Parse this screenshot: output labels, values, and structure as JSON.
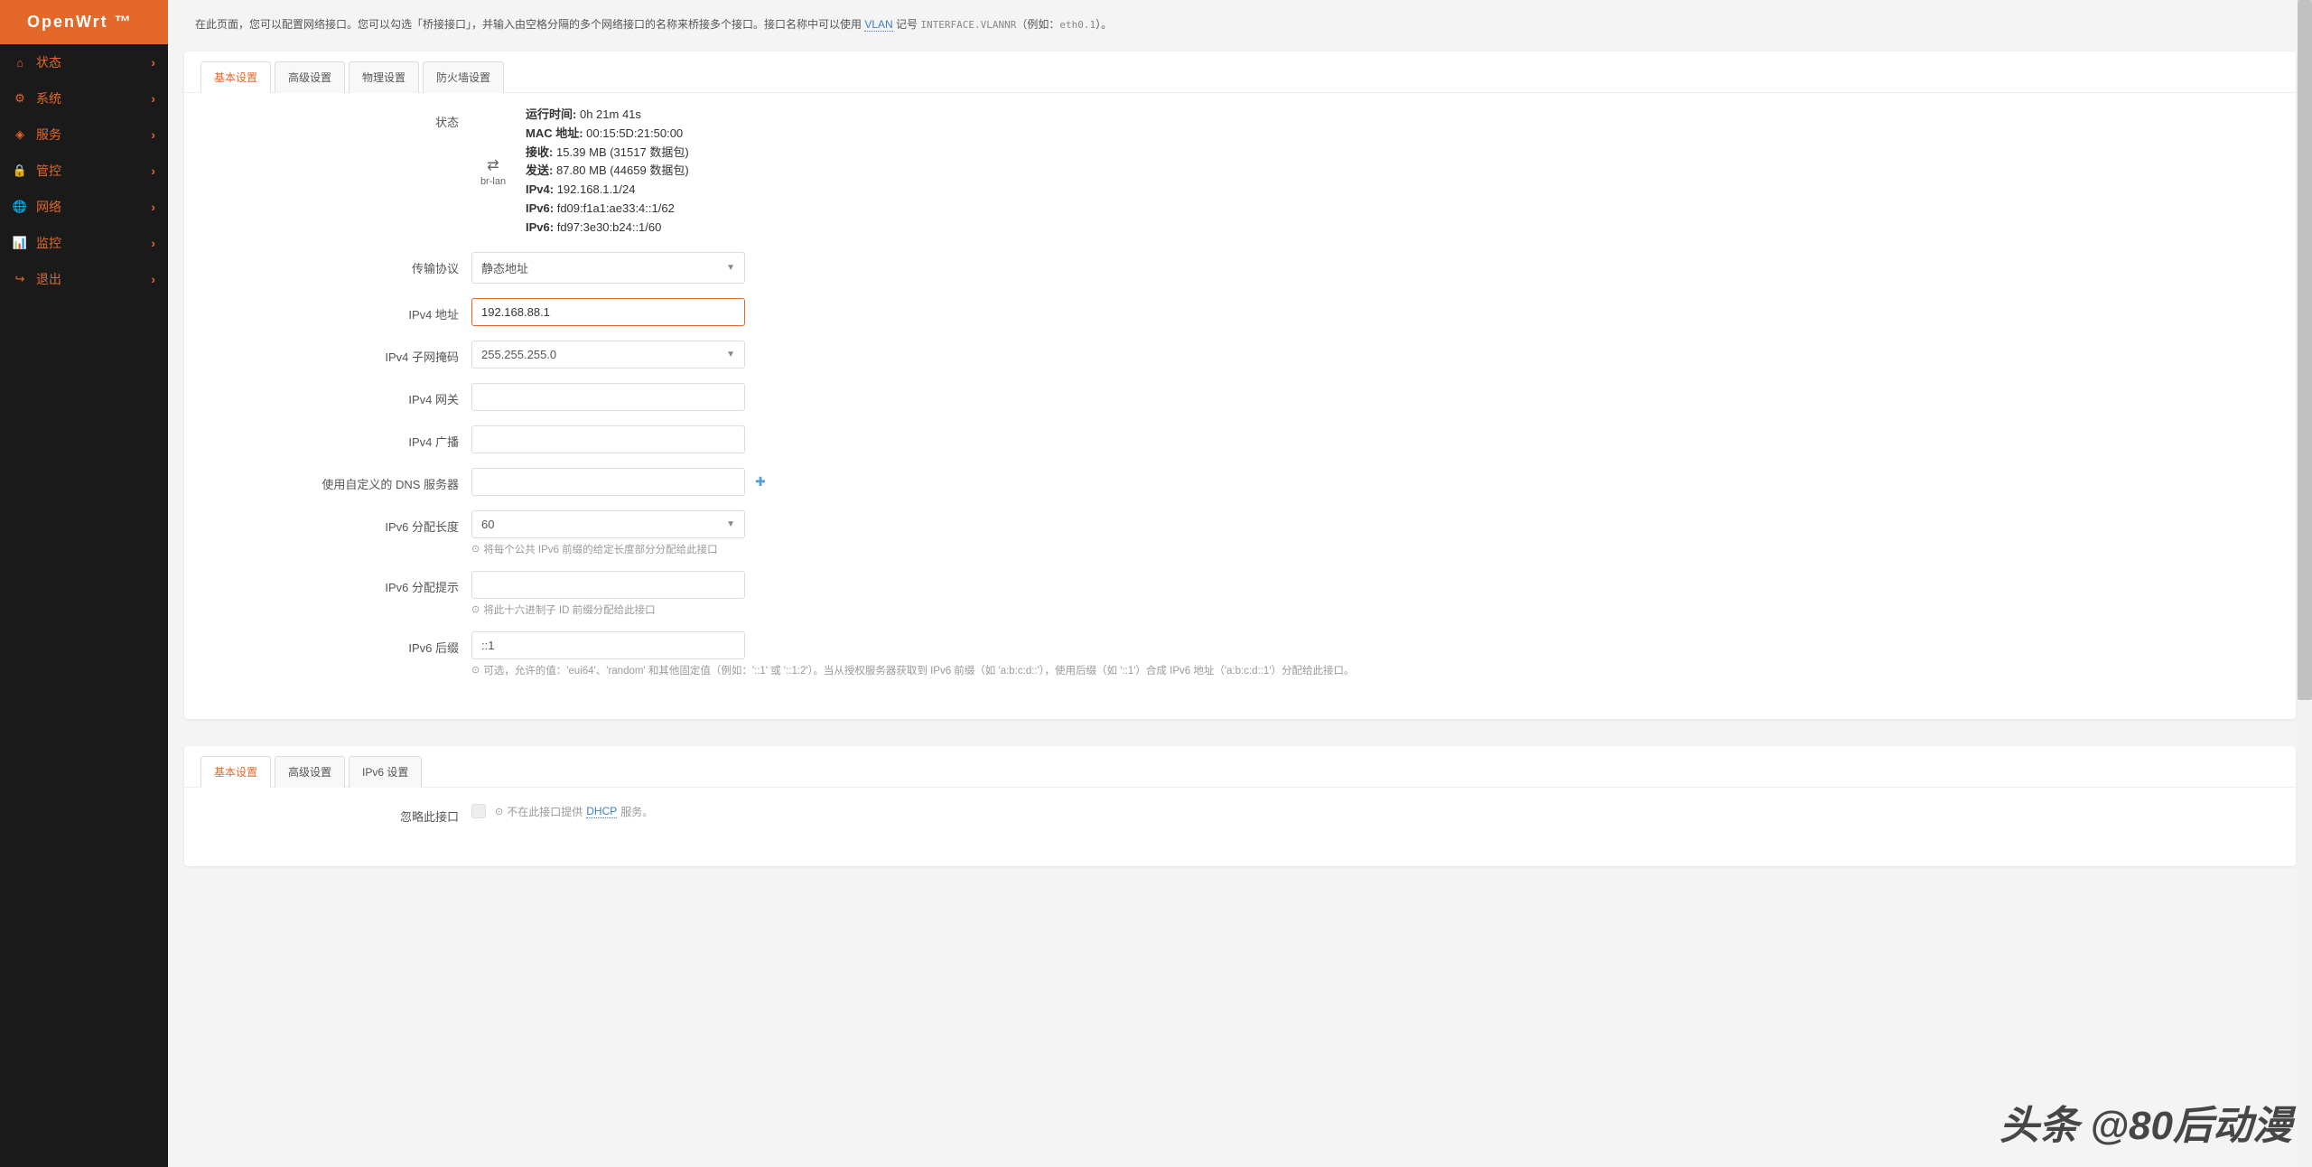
{
  "brand": "OpenWrt ™",
  "sidebar": {
    "items": [
      {
        "icon": "⌂",
        "icon_color": "#4a90d9",
        "label": "状态"
      },
      {
        "icon": "⚙",
        "icon_color": "#e4682a",
        "label": "系统"
      },
      {
        "icon": "◈",
        "icon_color": "#9b5de5",
        "label": "服务"
      },
      {
        "icon": "🔒",
        "icon_color": "#3ab0b0",
        "label": "管控"
      },
      {
        "icon": "🌐",
        "icon_color": "#4a90d9",
        "label": "网络"
      },
      {
        "icon": "📊",
        "icon_color": "#5cb85c",
        "label": "监控"
      },
      {
        "icon": "↪",
        "icon_color": "#d9534f",
        "label": "退出"
      }
    ]
  },
  "page": {
    "desc_prefix": "在此页面，您可以配置网络接口。您可以勾选「桥接接口」，并输入由空格分隔的多个网络接口的名称来桥接多个接口。接口名称中可以使用 ",
    "desc_link": "VLAN",
    "desc_mid": " 记号 ",
    "desc_code1": "INTERFACE.VLANNR",
    "desc_mid2": "（例如：",
    "desc_code2": "eth0.1",
    "desc_suffix": "）。"
  },
  "panel1": {
    "tabs": [
      {
        "label": "基本设置",
        "active": true
      },
      {
        "label": "高级设置",
        "active": false
      },
      {
        "label": "物理设置",
        "active": false
      },
      {
        "label": "防火墙设置",
        "active": false
      }
    ],
    "status": {
      "label": "状态",
      "iface_name": "br-lan",
      "uptime_k": "运行时间:",
      "uptime_v": "0h 21m 41s",
      "mac_k": "MAC 地址:",
      "mac_v": "00:15:5D:21:50:00",
      "rx_k": "接收:",
      "rx_v": "15.39 MB (31517 数据包)",
      "tx_k": "发送:",
      "tx_v": "87.80 MB (44659 数据包)",
      "ipv4_k": "IPv4:",
      "ipv4_v": "192.168.1.1/24",
      "ipv6a_k": "IPv6:",
      "ipv6a_v": "fd09:f1a1:ae33:4::1/62",
      "ipv6b_k": "IPv6:",
      "ipv6b_v": "fd97:3e30:b24::1/60"
    },
    "protocol": {
      "label": "传输协议",
      "value": "静态地址"
    },
    "ipv4_addr": {
      "label": "IPv4 地址",
      "value": "192.168.88.1"
    },
    "ipv4_mask": {
      "label": "IPv4 子网掩码",
      "value": "255.255.255.0"
    },
    "ipv4_gw": {
      "label": "IPv4 网关",
      "value": ""
    },
    "ipv4_bc": {
      "label": "IPv4 广播",
      "value": ""
    },
    "dns": {
      "label": "使用自定义的 DNS 服务器",
      "value": ""
    },
    "ipv6_len": {
      "label": "IPv6 分配长度",
      "value": "60",
      "help": "将每个公共 IPv6 前缀的给定长度部分分配给此接口"
    },
    "ipv6_hint": {
      "label": "IPv6 分配提示",
      "value": "",
      "help": "将此十六进制子 ID 前缀分配给此接口"
    },
    "ipv6_suffix": {
      "label": "IPv6 后缀",
      "value": "::1",
      "help": "可选，允许的值：'eui64'、'random' 和其他固定值（例如：'::1' 或 '::1:2'）。当从授权服务器获取到 IPv6 前缀（如 'a:b:c:d::'），使用后缀（如 '::1'）合成 IPv6 地址（'a:b:c:d::1'）分配给此接口。"
    }
  },
  "panel2": {
    "tabs": [
      {
        "label": "基本设置",
        "active": true
      },
      {
        "label": "高级设置",
        "active": false
      },
      {
        "label": "IPv6 设置",
        "active": false
      }
    ],
    "ignore": {
      "label": "忽略此接口",
      "help_prefix": "不在此接口提供 ",
      "help_link": "DHCP",
      "help_suffix": " 服务。"
    }
  },
  "watermark": "头条 @80后动漫"
}
